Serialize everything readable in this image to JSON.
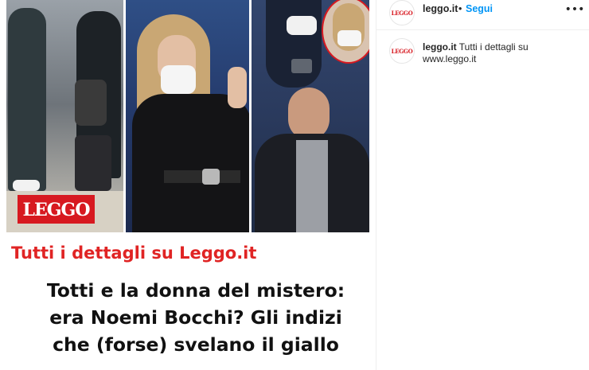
{
  "media": {
    "watermark_text": "LEGGO",
    "caption_link": "Tutti i dettagli su Leggo.it",
    "headline_lines": [
      "Totti e la donna del mistero:",
      "era Noemi Bocchi? Gli indizi",
      "che (forse) svelano il giallo"
    ],
    "brand_red": "#d71920",
    "caption_red": "#e02424"
  },
  "sidebar": {
    "header": {
      "avatar_text": "LEGGO",
      "username": "leggo.it",
      "separator": "•",
      "follow_label": "Segui",
      "more_label": "•••",
      "follow_color": "#0095f6"
    },
    "comment": {
      "avatar_text": "LEGGO",
      "username": "leggo.it",
      "text": "Tutti i dettagli su www.leggo.it"
    }
  }
}
